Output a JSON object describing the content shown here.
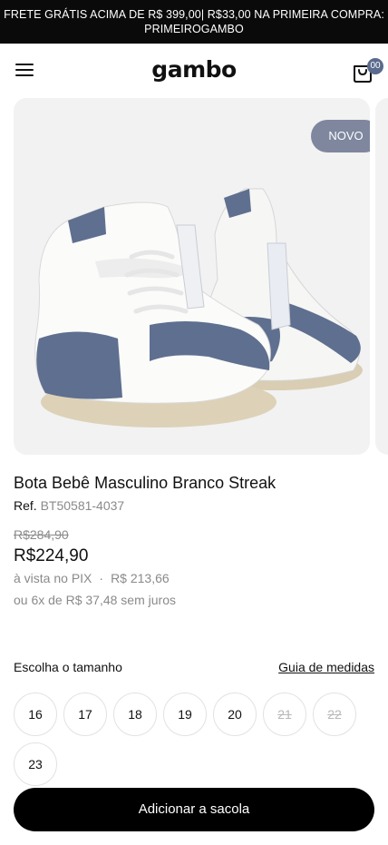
{
  "promo": {
    "line1": "FRETE GRÁTIS ACIMA DE R$ 399,00| R$33,00 NA PRIMEIRA COMPRA:",
    "line2": "PRIMEIROGAMBO"
  },
  "header": {
    "logo": "gambo",
    "bag_count": "00",
    "menu_icon": "hamburger-icon",
    "bag_icon": "shopping-bag-icon"
  },
  "product": {
    "badge": "NOVO",
    "title": "Bota Bebê Masculino Branco Streak",
    "ref_label": "Ref.",
    "ref_code": "BT50581-4037",
    "old_price": "R$284,90",
    "price": "R$224,90",
    "pix_label": "à vista no PIX",
    "pix_separator": "·",
    "pix_price": "R$ 213,66",
    "installments": "ou 6x de R$ 37,48 sem juros"
  },
  "sizes": {
    "label": "Escolha o tamanho",
    "guide": "Guia de medidas",
    "options": [
      {
        "value": "16",
        "available": true
      },
      {
        "value": "17",
        "available": true
      },
      {
        "value": "18",
        "available": true
      },
      {
        "value": "19",
        "available": true
      },
      {
        "value": "20",
        "available": true
      },
      {
        "value": "21",
        "available": false
      },
      {
        "value": "22",
        "available": false
      },
      {
        "value": "23",
        "available": true
      }
    ]
  },
  "cta": {
    "label": "Adicionar a sacola"
  },
  "colors": {
    "promo_bg": "#0a0a0a",
    "badge_bg": "#7e879e",
    "shoe_accent": "#5f6f8f",
    "cta_bg": "#000000"
  }
}
